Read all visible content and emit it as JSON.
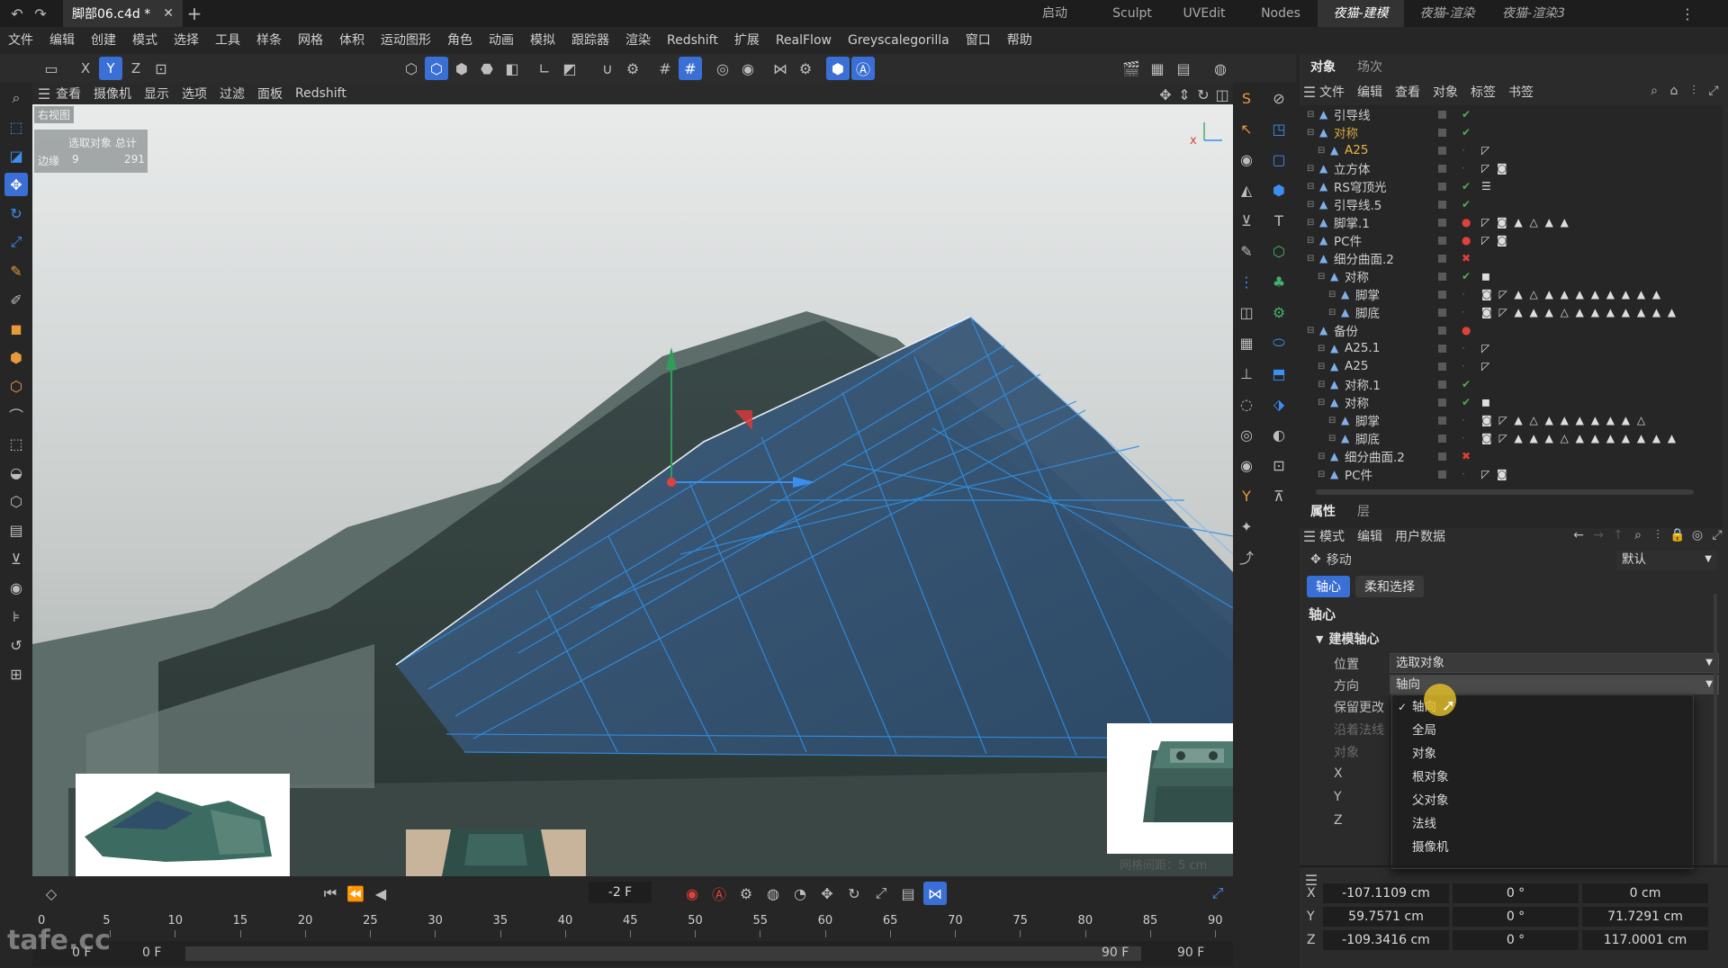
{
  "titlebar": {
    "file_tab": "脚部06.c4d *",
    "layouts": [
      "启动",
      "Sculpt",
      "UVEdit",
      "Nodes",
      "夜猫-建模",
      "夜猫-渲染",
      "夜猫-渲染3"
    ],
    "active_layout": "夜猫-建模"
  },
  "menubar": {
    "items": [
      "文件",
      "编辑",
      "创建",
      "模式",
      "选择",
      "工具",
      "样条",
      "网格",
      "体积",
      "运动图形",
      "角色",
      "动画",
      "模拟",
      "跟踪器",
      "渲染",
      "Redshift",
      "扩展",
      "RealFlow",
      "Greyscalegorilla",
      "窗口",
      "帮助"
    ]
  },
  "toolbar": {
    "axis_x": "X",
    "axis_y": "Y",
    "axis_z": "Z"
  },
  "viewport_menu": {
    "items": [
      "查看",
      "摄像机",
      "显示",
      "选项",
      "过滤",
      "面板",
      "Redshift"
    ]
  },
  "viewport": {
    "view_name": "右视图",
    "stats_header": "选取对象  总计",
    "stats_label": "边缘",
    "stats_selected": "9",
    "stats_total": "291",
    "grid_spacing": "网格间距：5 cm"
  },
  "timeline": {
    "frame_current": "-2 F",
    "ticks": [
      "0",
      "5",
      "10",
      "15",
      "20",
      "25",
      "30",
      "35",
      "40",
      "45",
      "50",
      "55",
      "60",
      "65",
      "70",
      "75",
      "80",
      "85",
      "90"
    ],
    "start_a": "0 F",
    "start_b": "0 F",
    "end_a": "90 F",
    "end_b": "90 F"
  },
  "watermark": "tafe.cc",
  "object_manager": {
    "tabs": [
      "对象",
      "场次"
    ],
    "menu": [
      "文件",
      "编辑",
      "查看",
      "对象",
      "标签",
      "书签"
    ],
    "rows": [
      {
        "name": "引导线",
        "indent": 0,
        "status": "check",
        "tags": ""
      },
      {
        "name": "对称",
        "indent": 0,
        "status": "check",
        "tags": "",
        "color": "#d8a640"
      },
      {
        "name": "A25",
        "indent": 1,
        "status": "",
        "tags": "◸",
        "color": "#e9b545"
      },
      {
        "name": "立方体",
        "indent": 0,
        "status": "",
        "tags": "◸ ◙"
      },
      {
        "name": "RS穹顶光",
        "indent": 0,
        "status": "check",
        "tags": "☰"
      },
      {
        "name": "引导线.5",
        "indent": 0,
        "status": "check",
        "tags": ""
      },
      {
        "name": "脚掌.1",
        "indent": 0,
        "status": "dot",
        "tags": "◸ ◙ ▲ △ ▲ ▲"
      },
      {
        "name": "PC件",
        "indent": 0,
        "status": "dot",
        "tags": "◸ ◙"
      },
      {
        "name": "细分曲面.2",
        "indent": 0,
        "status": "cross",
        "tags": ""
      },
      {
        "name": "对称",
        "indent": 1,
        "status": "check",
        "tags": "◼"
      },
      {
        "name": "脚掌",
        "indent": 2,
        "status": "",
        "tags": "◙ ◸ ▲ △ ▲ ▲ ▲ ▲ ▲ ▲ ▲ ▲"
      },
      {
        "name": "脚底",
        "indent": 2,
        "status": "",
        "tags": "◙ ◸ ▲ ▲ ▲ △ ▲ ▲ ▲ ▲ ▲ ▲ ▲"
      },
      {
        "name": "备份",
        "indent": 0,
        "status": "dot",
        "tags": ""
      },
      {
        "name": "A25.1",
        "indent": 1,
        "status": "",
        "tags": "◸"
      },
      {
        "name": "A25",
        "indent": 1,
        "status": "",
        "tags": "◸"
      },
      {
        "name": "对称.1",
        "indent": 1,
        "status": "check",
        "tags": ""
      },
      {
        "name": "对称",
        "indent": 1,
        "status": "check",
        "tags": "◼"
      },
      {
        "name": "脚掌",
        "indent": 2,
        "status": "",
        "tags": "◙ ◸ ▲ △ ▲ ▲ ▲ ▲ ▲ ▲ △"
      },
      {
        "name": "脚底",
        "indent": 2,
        "status": "",
        "tags": "◙ ◸ ▲ ▲ ▲ △ ▲ ▲ ▲ ▲ ▲ ▲ ▲"
      },
      {
        "name": "细分曲面.2",
        "indent": 1,
        "status": "cross",
        "tags": ""
      },
      {
        "name": "PC件",
        "indent": 1,
        "status": "",
        "tags": "◸ ◙"
      }
    ]
  },
  "attributes": {
    "tabs": [
      "属性",
      "层"
    ],
    "menu": [
      "模式",
      "编辑",
      "用户数据"
    ],
    "tool_name": "移动",
    "preset": "默认",
    "subtabs": [
      "轴心",
      "柔和选择"
    ],
    "section": "轴心",
    "group": "建模轴心",
    "position_label": "位置",
    "position_value": "选取对象",
    "direction_label": "方向",
    "direction_value": "轴向",
    "keep_label": "保留更改",
    "along_label": "沿着法线",
    "object_label": "对象",
    "x_label": "X",
    "y_label": "Y",
    "z_label": "Z",
    "dropdown_options": [
      "轴向",
      "全局",
      "对象",
      "根对象",
      "父对象",
      "法线",
      "摄像机"
    ],
    "dropdown_selected": "轴向"
  },
  "coordinates": {
    "rows": [
      {
        "axis": "X",
        "pos": "-107.1109 cm",
        "rot": "0 °",
        "size": "0 cm"
      },
      {
        "axis": "Y",
        "pos": "59.7571 cm",
        "rot": "0 °",
        "size": "71.7291 cm"
      },
      {
        "axis": "Z",
        "pos": "-109.3416 cm",
        "rot": "0 °",
        "size": "117.0001 cm"
      }
    ]
  },
  "colors": {
    "accent": "#3a6fd6",
    "mesh_blue": "#2f7fd3",
    "selection_orange": "#e9b545",
    "check_green": "#4caf50",
    "cross_red": "#e0413a"
  }
}
